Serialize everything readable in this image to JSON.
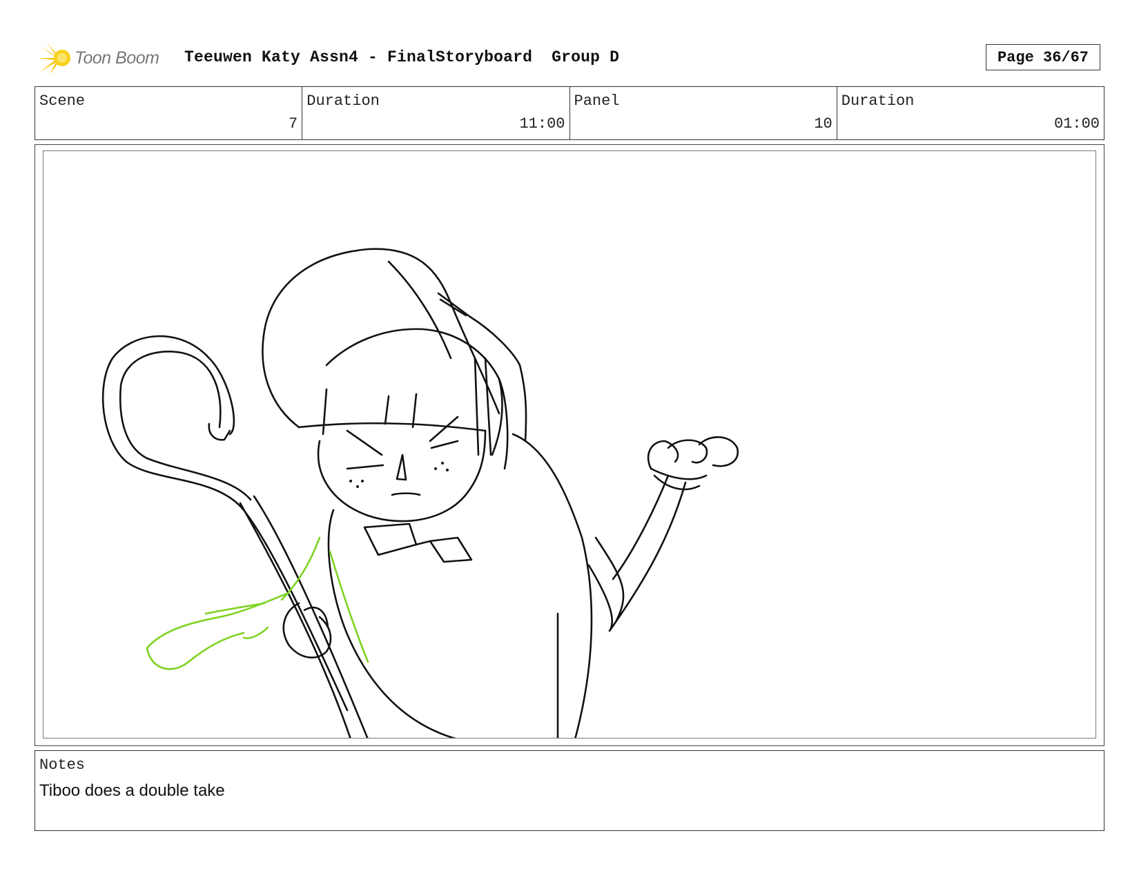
{
  "header": {
    "logo_text": "Toon Boom",
    "title": "Teeuwen Katy Assn4 - FinalStoryboard  Group D",
    "page": "Page 36/67"
  },
  "info": {
    "scene_label": "Scene",
    "scene_value": "7",
    "scene_duration_label": "Duration",
    "scene_duration_value": "11:00",
    "panel_label": "Panel",
    "panel_value": "10",
    "panel_duration_label": "Duration",
    "panel_duration_value": "01:00"
  },
  "notes": {
    "label": "Notes",
    "text": "Tiboo does a double take"
  },
  "colors": {
    "sketch_line": "#111111",
    "motion_accent": "#7ed321",
    "logo_yellow": "#f5c400"
  },
  "icons": {
    "logo": "starburst-icon"
  }
}
